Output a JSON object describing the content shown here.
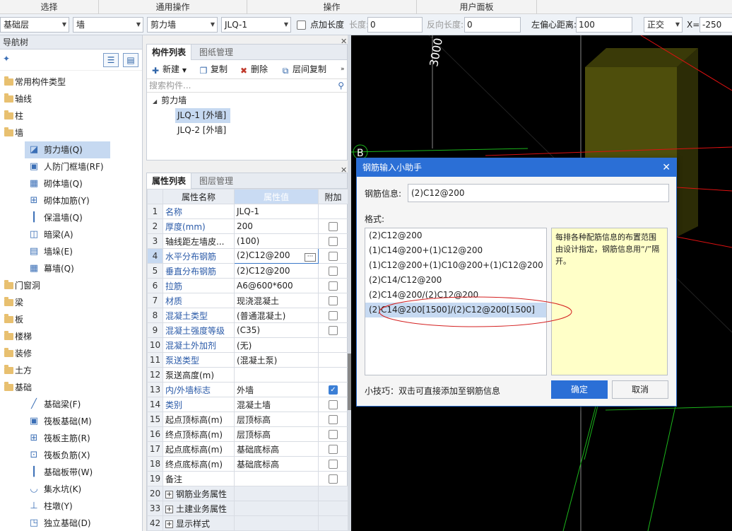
{
  "ribbon": {
    "groups": [
      "选择",
      "通用操作",
      "操作",
      "用户面板"
    ]
  },
  "toolbar": {
    "floor": "基础层",
    "category": "墙",
    "type": "剪力墙",
    "component": "JLQ-1",
    "add_length_label": "点加长度",
    "length_label": "长度:",
    "length_value": "0",
    "reverse_length_label": "反向长度:",
    "reverse_length_value": "0",
    "offset_label": "左偏心距离:",
    "offset_value": "100",
    "ortho": "正交",
    "x_label": "X=",
    "x_value": "-250"
  },
  "nav": {
    "title": "导航树",
    "items": [
      {
        "label": "常用构件类型",
        "level": 0,
        "icon": "folder"
      },
      {
        "label": "轴线",
        "level": 0,
        "icon": "folder"
      },
      {
        "label": "柱",
        "level": 0,
        "icon": "folder"
      },
      {
        "label": "墙",
        "level": 0,
        "icon": "folder"
      },
      {
        "label": "剪力墙(Q)",
        "level": 1,
        "icon": "shear-wall-icon",
        "glyph": "◪",
        "selected": true
      },
      {
        "label": "人防门框墙(RF)",
        "level": 1,
        "icon": "door-frame-wall-icon",
        "glyph": "▣"
      },
      {
        "label": "砌体墙(Q)",
        "level": 1,
        "icon": "masonry-wall-icon",
        "glyph": "▦"
      },
      {
        "label": "砌体加筋(Y)",
        "level": 1,
        "icon": "masonry-rebar-icon",
        "glyph": "⊞"
      },
      {
        "label": "保温墙(Q)",
        "level": 1,
        "icon": "insulation-wall-icon",
        "glyph": "┃"
      },
      {
        "label": "暗梁(A)",
        "level": 1,
        "icon": "hidden-beam-icon",
        "glyph": "◫"
      },
      {
        "label": "墙垛(E)",
        "level": 1,
        "icon": "wall-pier-icon",
        "glyph": "▤"
      },
      {
        "label": "幕墙(Q)",
        "level": 1,
        "icon": "curtain-wall-icon",
        "glyph": "▦"
      },
      {
        "label": "门窗洞",
        "level": 0,
        "icon": "folder"
      },
      {
        "label": "梁",
        "level": 0,
        "icon": "folder"
      },
      {
        "label": "板",
        "level": 0,
        "icon": "folder"
      },
      {
        "label": "楼梯",
        "level": 0,
        "icon": "folder"
      },
      {
        "label": "装修",
        "level": 0,
        "icon": "folder"
      },
      {
        "label": "土方",
        "level": 0,
        "icon": "folder"
      },
      {
        "label": "基础",
        "level": 0,
        "icon": "folder"
      },
      {
        "label": "基础梁(F)",
        "level": 1,
        "icon": "foundation-beam-icon",
        "glyph": "╱"
      },
      {
        "label": "筏板基础(M)",
        "level": 1,
        "icon": "raft-foundation-icon",
        "glyph": "▣"
      },
      {
        "label": "筏板主筋(R)",
        "level": 1,
        "icon": "raft-main-rebar-icon",
        "glyph": "⊞"
      },
      {
        "label": "筏板负筋(X)",
        "level": 1,
        "icon": "raft-neg-rebar-icon",
        "glyph": "⊡"
      },
      {
        "label": "基础板带(W)",
        "level": 1,
        "icon": "foundation-strip-icon",
        "glyph": "┃"
      },
      {
        "label": "集水坑(K)",
        "level": 1,
        "icon": "sump-pit-icon",
        "glyph": "◡"
      },
      {
        "label": "柱墩(Y)",
        "level": 1,
        "icon": "column-pier-icon",
        "glyph": "⊥"
      },
      {
        "label": "独立基础(D)",
        "level": 1,
        "icon": "isolated-foundation-icon",
        "glyph": "◳"
      }
    ]
  },
  "components": {
    "tab_list": "构件列表",
    "tab_drawing": "图纸管理",
    "new_label": "新建",
    "copy_label": "复制",
    "delete_label": "删除",
    "floor_copy_label": "层间复制",
    "search_placeholder": "搜索构件...",
    "tree_root": "剪力墙",
    "tree_items": [
      "JLQ-1 [外墙]",
      "JLQ-2 [外墙]"
    ]
  },
  "properties": {
    "tab_list": "属性列表",
    "tab_layer": "图层管理",
    "col_name": "属性名称",
    "col_value": "属性值",
    "col_extra": "附加",
    "rows": [
      {
        "num": "1",
        "name": "名称",
        "value": "JLQ-1",
        "blue": true,
        "check": "none"
      },
      {
        "num": "2",
        "name": "厚度(mm)",
        "value": "200",
        "blue": true,
        "check": "off"
      },
      {
        "num": "3",
        "name": "轴线距左墙皮...",
        "value": "(100)",
        "blue": false,
        "check": "off"
      },
      {
        "num": "4",
        "name": "水平分布钢筋",
        "value": "(2)C12@200",
        "blue": true,
        "check": "off",
        "selected": true
      },
      {
        "num": "5",
        "name": "垂直分布钢筋",
        "value": "(2)C12@200",
        "blue": true,
        "check": "off"
      },
      {
        "num": "6",
        "name": "拉筋",
        "value": "A6@600*600",
        "blue": true,
        "check": "off"
      },
      {
        "num": "7",
        "name": "材质",
        "value": "现浇混凝土",
        "blue": true,
        "check": "off"
      },
      {
        "num": "8",
        "name": "混凝土类型",
        "value": "(普通混凝土)",
        "blue": true,
        "check": "off"
      },
      {
        "num": "9",
        "name": "混凝土强度等级",
        "value": "(C35)",
        "blue": true,
        "check": "off"
      },
      {
        "num": "10",
        "name": "混凝土外加剂",
        "value": "(无)",
        "blue": true,
        "check": "none"
      },
      {
        "num": "11",
        "name": "泵送类型",
        "value": "(混凝土泵)",
        "blue": true,
        "check": "none"
      },
      {
        "num": "12",
        "name": "泵送高度(m)",
        "value": "",
        "blue": false,
        "check": "none"
      },
      {
        "num": "13",
        "name": "内/外墙标志",
        "value": "外墙",
        "blue": true,
        "check": "on"
      },
      {
        "num": "14",
        "name": "类别",
        "value": "混凝土墙",
        "blue": true,
        "check": "off"
      },
      {
        "num": "15",
        "name": "起点顶标高(m)",
        "value": "层顶标高",
        "blue": false,
        "check": "off"
      },
      {
        "num": "16",
        "name": "终点顶标高(m)",
        "value": "层顶标高",
        "blue": false,
        "check": "off"
      },
      {
        "num": "17",
        "name": "起点底标高(m)",
        "value": "基础底标高",
        "blue": false,
        "check": "off"
      },
      {
        "num": "18",
        "name": "终点底标高(m)",
        "value": "基础底标高",
        "blue": false,
        "check": "off"
      },
      {
        "num": "19",
        "name": "备注",
        "value": "",
        "blue": false,
        "check": "off"
      },
      {
        "num": "20",
        "name": "钢筋业务属性",
        "value": "",
        "group": true
      },
      {
        "num": "33",
        "name": "土建业务属性",
        "value": "",
        "group": true
      },
      {
        "num": "42",
        "name": "显示样式",
        "value": "",
        "group": true
      }
    ]
  },
  "viewport": {
    "dimension_text": "3000",
    "axis_label": "B"
  },
  "dialog": {
    "title": "钢筋输入小助手",
    "info_label": "钢筋信息:",
    "info_value": "(2)C12@200",
    "format_label": "格式:",
    "formats": [
      "(2)C12@200",
      "(1)C14@200+(1)C12@200",
      "(1)C12@200+(1)C10@200+(1)C12@200",
      "(2)C14/C12@200",
      "(2)C14@200/(2)C12@200",
      "(2)C14@200[1500]/(2)C12@200[1500]"
    ],
    "selected_index": 5,
    "tip_text": "每排各种配筋信息的布置范围由设计指定，钢筋信息用“/”隔开。",
    "hint": "小技巧：双击可直接添加至钢筋信息",
    "ok_label": "确定",
    "cancel_label": "取消"
  }
}
